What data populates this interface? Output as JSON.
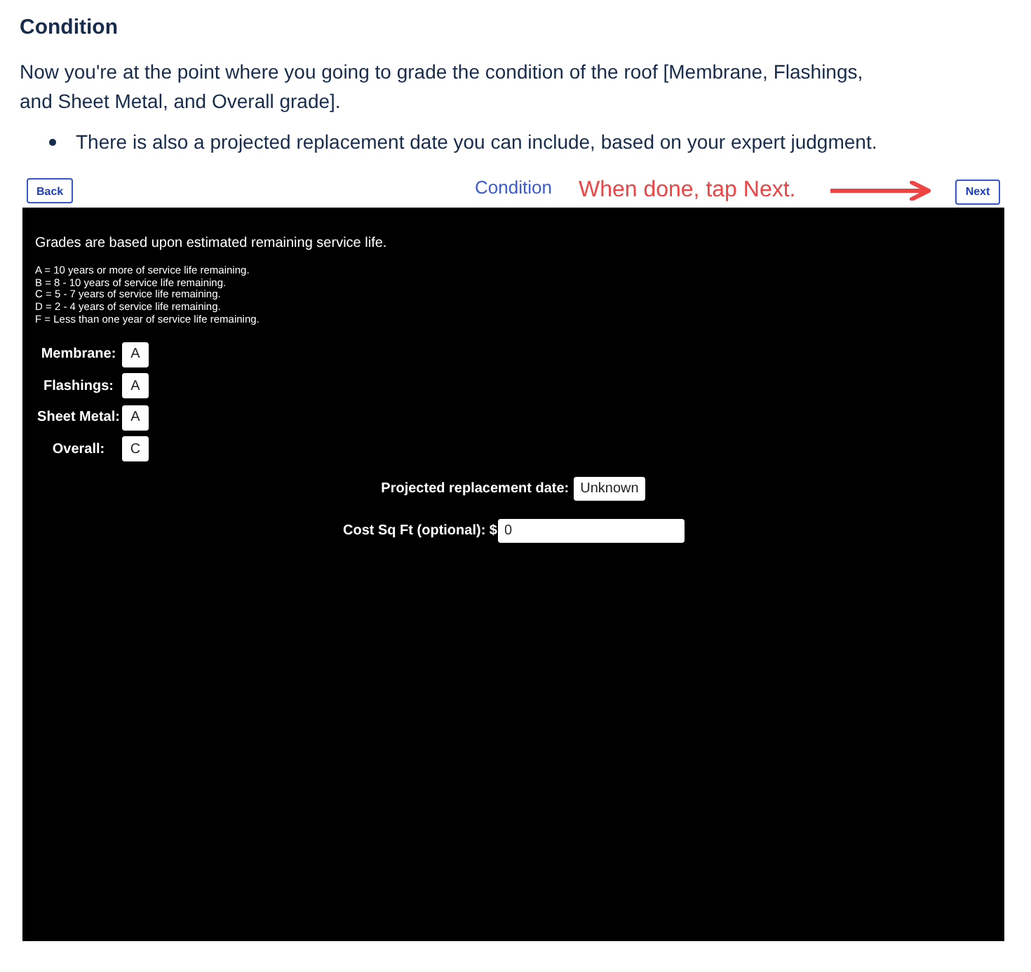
{
  "article": {
    "heading": "Condition",
    "paragraph": "Now you're at the point where you going to grade the condition of the roof [Membrane, Flashings, and Sheet Metal, and Overall grade].",
    "bullets": [
      "There is also a projected replacement date you can include, based on your expert judgment."
    ]
  },
  "screenshot": {
    "toolbar": {
      "back_button": "Back",
      "title": "Condition",
      "annotation": "When done, tap Next.",
      "next_button": "Next"
    },
    "intro": "Grades are based upon estimated remaining service life.",
    "legend": [
      "A = 10 years or more of service life remaining.",
      "B = 8 - 10 years of service life remaining.",
      "C = 5 - 7 years of service life remaining.",
      "D = 2 - 4 years of service life remaining.",
      "F = Less than one year of service life remaining."
    ],
    "grades": [
      {
        "label": "Membrane:",
        "value": "A"
      },
      {
        "label": "Flashings:",
        "value": "A"
      },
      {
        "label": "Sheet Metal:",
        "value": "A"
      },
      {
        "label": "Overall:",
        "value": "C"
      }
    ],
    "replacement_date": {
      "label": "Projected replacement date:",
      "value": "Unknown"
    },
    "cost": {
      "label": "Cost Sq Ft (optional): $",
      "value": "0"
    }
  }
}
